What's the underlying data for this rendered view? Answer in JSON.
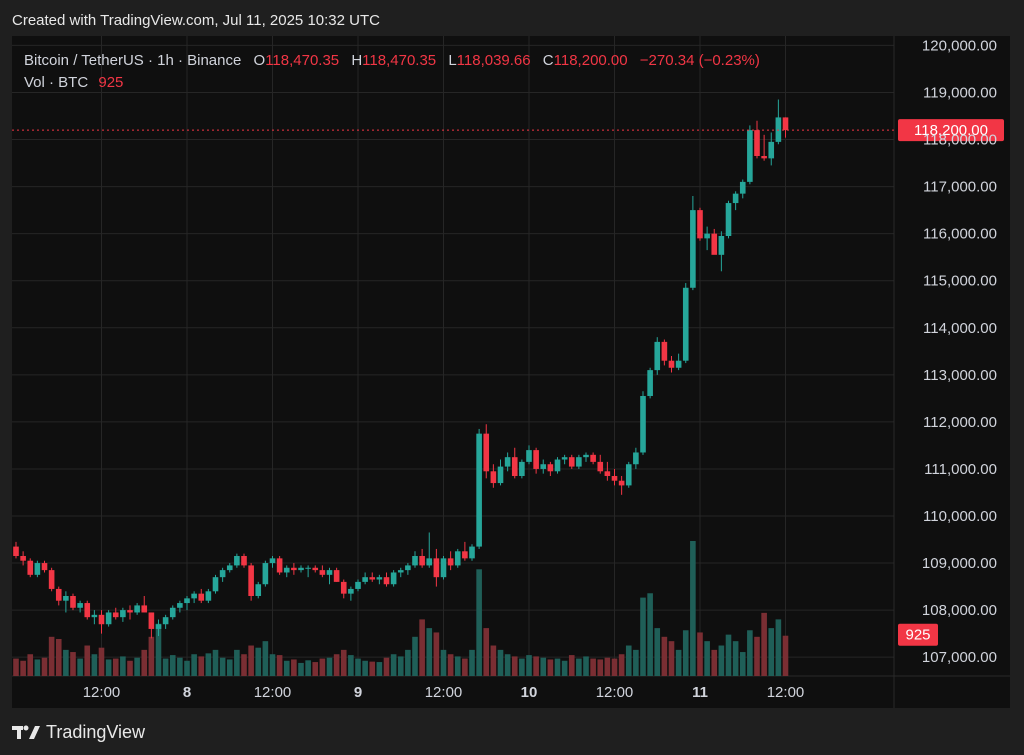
{
  "header": {
    "created_text": "Created with TradingView.com, Jul 11, 2025 10:32 UTC"
  },
  "legend": {
    "symbol": "Bitcoin / TetherUS · 1h · Binance",
    "o_label": "O",
    "o_value": "118,470.35",
    "h_label": "H",
    "h_value": "118,470.35",
    "l_label": "L",
    "l_value": "118,039.66",
    "c_label": "C",
    "c_value": "118,200.00",
    "change": "−270.34 (−0.23%)",
    "vol_label": "Vol · BTC",
    "vol_value": "925"
  },
  "footer": {
    "brand": "TradingView"
  },
  "colors": {
    "up": "#26a69a",
    "down": "#f23645",
    "vol_up": "#1f5f58",
    "vol_down": "#7a2e33",
    "background": "#0f0f0f",
    "grid": "#262626",
    "text": "#d1d4dc"
  },
  "chart_data": {
    "type": "candlestick",
    "symbol": "Bitcoin / TetherUS",
    "interval": "1h",
    "exchange": "Binance",
    "ylim": [
      106600,
      120200
    ],
    "y_ticks": [
      "120,000.00",
      "119,000.00",
      "118,000.00",
      "117,000.00",
      "116,000.00",
      "115,000.00",
      "114,000.00",
      "113,000.00",
      "112,000.00",
      "111,000.00",
      "110,000.00",
      "109,000.00",
      "108,000.00",
      "107,000.00"
    ],
    "y_tick_values": [
      120000,
      119000,
      118000,
      117000,
      116000,
      115000,
      114000,
      113000,
      112000,
      111000,
      110000,
      109000,
      108000,
      107000
    ],
    "x_tick_labels": [
      "12:00",
      "8",
      "12:00",
      "9",
      "12:00",
      "10",
      "12:00",
      "11",
      "12:00"
    ],
    "x_tick_bold": [
      false,
      true,
      false,
      true,
      false,
      true,
      false,
      true,
      false
    ],
    "x_tick_bar_index": [
      12,
      24,
      36,
      48,
      60,
      72,
      84,
      96,
      108
    ],
    "last_price_label": "118,200.00",
    "last_price": 118200,
    "volume_label": "925",
    "grid": true,
    "candles": [
      [
        109350,
        109450,
        109100,
        109150,
        400
      ],
      [
        109150,
        109250,
        108950,
        109050,
        350
      ],
      [
        109050,
        109100,
        108700,
        108750,
        500
      ],
      [
        108750,
        109050,
        108700,
        109000,
        380
      ],
      [
        109000,
        109050,
        108800,
        108850,
        420
      ],
      [
        108850,
        108900,
        108400,
        108450,
        900
      ],
      [
        108450,
        108500,
        108100,
        108200,
        850
      ],
      [
        108200,
        108400,
        107950,
        108300,
        600
      ],
      [
        108300,
        108350,
        108000,
        108050,
        550
      ],
      [
        108050,
        108200,
        107950,
        108150,
        400
      ],
      [
        108150,
        108200,
        107800,
        107850,
        700
      ],
      [
        107850,
        108000,
        107700,
        107900,
        500
      ],
      [
        107900,
        108000,
        107500,
        107700,
        650
      ],
      [
        107700,
        108000,
        107650,
        107950,
        380
      ],
      [
        107950,
        108050,
        107800,
        107850,
        400
      ],
      [
        107850,
        108050,
        107750,
        108000,
        450
      ],
      [
        108000,
        108100,
        107800,
        107950,
        350
      ],
      [
        107950,
        108150,
        107900,
        108100,
        420
      ],
      [
        108100,
        108300,
        107950,
        107950,
        600
      ],
      [
        107950,
        107950,
        107400,
        107600,
        900
      ],
      [
        107600,
        107800,
        107450,
        107700,
        1200
      ],
      [
        107700,
        107900,
        107600,
        107850,
        400
      ],
      [
        107850,
        108100,
        107800,
        108050,
        480
      ],
      [
        108050,
        108200,
        107950,
        108150,
        420
      ],
      [
        108150,
        108300,
        108000,
        108250,
        350
      ],
      [
        108250,
        108400,
        108150,
        108350,
        500
      ],
      [
        108350,
        108450,
        108150,
        108200,
        450
      ],
      [
        108200,
        108450,
        108150,
        108400,
        520
      ],
      [
        108400,
        108750,
        108350,
        108700,
        600
      ],
      [
        108700,
        108900,
        108600,
        108850,
        420
      ],
      [
        108850,
        109000,
        108800,
        108950,
        380
      ],
      [
        108950,
        109200,
        108900,
        109150,
        600
      ],
      [
        109150,
        109200,
        108900,
        108950,
        500
      ],
      [
        108950,
        109000,
        108200,
        108300,
        700
      ],
      [
        108300,
        108600,
        108250,
        108550,
        650
      ],
      [
        108550,
        109050,
        108500,
        109000,
        800
      ],
      [
        109000,
        109150,
        108900,
        109100,
        500
      ],
      [
        109100,
        109150,
        108750,
        108800,
        480
      ],
      [
        108800,
        108950,
        108700,
        108900,
        350
      ],
      [
        108900,
        109000,
        108750,
        108850,
        380
      ],
      [
        108850,
        108950,
        108800,
        108900,
        300
      ],
      [
        108900,
        108950,
        108700,
        108900,
        360
      ],
      [
        108900,
        108950,
        108800,
        108850,
        320
      ],
      [
        108850,
        108950,
        108700,
        108750,
        400
      ],
      [
        108750,
        108900,
        108550,
        108850,
        420
      ],
      [
        108850,
        108900,
        108600,
        108600,
        500
      ],
      [
        108600,
        108650,
        108250,
        108350,
        600
      ],
      [
        108350,
        108500,
        108200,
        108450,
        480
      ],
      [
        108450,
        108650,
        108400,
        108600,
        400
      ],
      [
        108600,
        108800,
        108550,
        108700,
        350
      ],
      [
        108700,
        108800,
        108600,
        108650,
        330
      ],
      [
        108650,
        108750,
        108550,
        108700,
        320
      ],
      [
        108700,
        108800,
        108500,
        108550,
        420
      ],
      [
        108550,
        108850,
        108500,
        108800,
        500
      ],
      [
        108800,
        108900,
        108700,
        108850,
        450
      ],
      [
        108850,
        109000,
        108750,
        108950,
        600
      ],
      [
        108950,
        109250,
        108900,
        109150,
        900
      ],
      [
        109150,
        109300,
        108900,
        108950,
        1300
      ],
      [
        108950,
        109650,
        108900,
        109100,
        1100
      ],
      [
        109100,
        109300,
        108500,
        108700,
        1000
      ],
      [
        108700,
        109150,
        108650,
        109100,
        600
      ],
      [
        109100,
        109250,
        108850,
        108950,
        500
      ],
      [
        108950,
        109300,
        108900,
        109250,
        450
      ],
      [
        109250,
        109450,
        109050,
        109100,
        400
      ],
      [
        109100,
        109400,
        109050,
        109350,
        600
      ],
      [
        109350,
        111850,
        109300,
        111750,
        2450
      ],
      [
        111750,
        111950,
        110800,
        110950,
        1100
      ],
      [
        110950,
        111100,
        110600,
        110700,
        700
      ],
      [
        110700,
        111200,
        110650,
        111050,
        600
      ],
      [
        111050,
        111350,
        110950,
        111250,
        500
      ],
      [
        111250,
        111450,
        110800,
        110850,
        450
      ],
      [
        110850,
        111200,
        110800,
        111150,
        400
      ],
      [
        111150,
        111500,
        111100,
        111400,
        480
      ],
      [
        111400,
        111450,
        110900,
        111000,
        450
      ],
      [
        111000,
        111200,
        110900,
        111100,
        420
      ],
      [
        111100,
        111150,
        110850,
        110950,
        380
      ],
      [
        110950,
        111250,
        110900,
        111200,
        400
      ],
      [
        111200,
        111300,
        111100,
        111250,
        350
      ],
      [
        111250,
        111300,
        111000,
        111050,
        480
      ],
      [
        111050,
        111300,
        111000,
        111250,
        400
      ],
      [
        111250,
        111350,
        111150,
        111300,
        450
      ],
      [
        111300,
        111350,
        111100,
        111150,
        400
      ],
      [
        111150,
        111300,
        110900,
        110950,
        380
      ],
      [
        110950,
        111150,
        110750,
        110850,
        420
      ],
      [
        110850,
        111000,
        110650,
        110750,
        400
      ],
      [
        110750,
        110850,
        110450,
        110650,
        500
      ],
      [
        110650,
        111150,
        110600,
        111100,
        700
      ],
      [
        111100,
        111450,
        111000,
        111350,
        600
      ],
      [
        111350,
        112650,
        111300,
        112550,
        1800
      ],
      [
        112550,
        113150,
        112500,
        113100,
        1900
      ],
      [
        113100,
        113800,
        113000,
        113700,
        1100
      ],
      [
        113700,
        113750,
        113200,
        113300,
        900
      ],
      [
        113300,
        113400,
        113050,
        113150,
        800
      ],
      [
        113150,
        113450,
        113100,
        113300,
        600
      ],
      [
        113300,
        114950,
        113250,
        114850,
        1050
      ],
      [
        114850,
        116800,
        114800,
        116500,
        3100
      ],
      [
        116500,
        116550,
        115850,
        115900,
        1000
      ],
      [
        115900,
        116150,
        115650,
        116000,
        800
      ],
      [
        116000,
        116100,
        115600,
        115550,
        600
      ],
      [
        115550,
        116050,
        115200,
        115950,
        700
      ],
      [
        115950,
        116700,
        115900,
        116650,
        950
      ],
      [
        116650,
        116900,
        116500,
        116850,
        800
      ],
      [
        116850,
        117150,
        116750,
        117100,
        550
      ],
      [
        117100,
        118300,
        117050,
        118200,
        1050
      ],
      [
        118200,
        118400,
        117600,
        117650,
        900
      ],
      [
        117650,
        118100,
        117550,
        117600,
        1450
      ],
      [
        117600,
        118150,
        117450,
        117950,
        1100
      ],
      [
        117950,
        118850,
        117900,
        118470,
        1300
      ],
      [
        118470,
        118470,
        118040,
        118200,
        925
      ]
    ]
  }
}
